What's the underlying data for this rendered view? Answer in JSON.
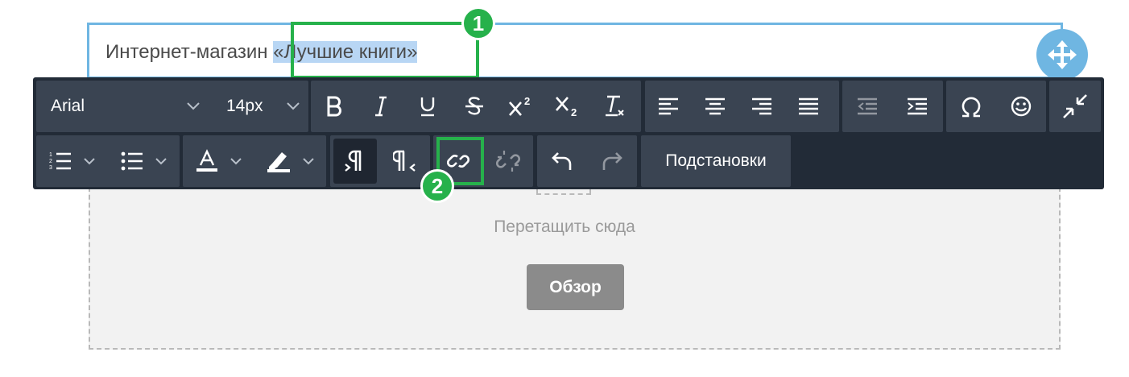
{
  "heading": {
    "prefix": "Интернет-магазин ",
    "selected": "«Лучшие книги»"
  },
  "badges": {
    "first": "1",
    "second": "2"
  },
  "toolbar": {
    "font_family": "Arial",
    "font_size": "14px",
    "labels": {
      "placeholders": "Подстановки"
    },
    "icons": [
      "bold-icon",
      "italic-icon",
      "underline-icon",
      "strikethrough-icon",
      "superscript-icon",
      "subscript-icon",
      "clear-format-icon",
      "align-left-icon",
      "align-center-icon",
      "align-right-icon",
      "align-justify-icon",
      "outdent-icon",
      "indent-icon",
      "special-char-icon",
      "emoji-icon",
      "collapse-icon",
      "ordered-list-icon",
      "unordered-list-icon",
      "text-color-icon",
      "highlight-icon",
      "ltr-icon",
      "rtl-icon",
      "link-icon",
      "unlink-icon",
      "undo-icon",
      "redo-icon"
    ]
  },
  "dropzone": {
    "text": "Перетащить сюда",
    "button": "Обзор"
  },
  "colors": {
    "selection_border": "#6fb6e2",
    "highlight": "#26b14b",
    "toolbar_bg": "#222b37",
    "toolbar_group": "#3a4452"
  }
}
